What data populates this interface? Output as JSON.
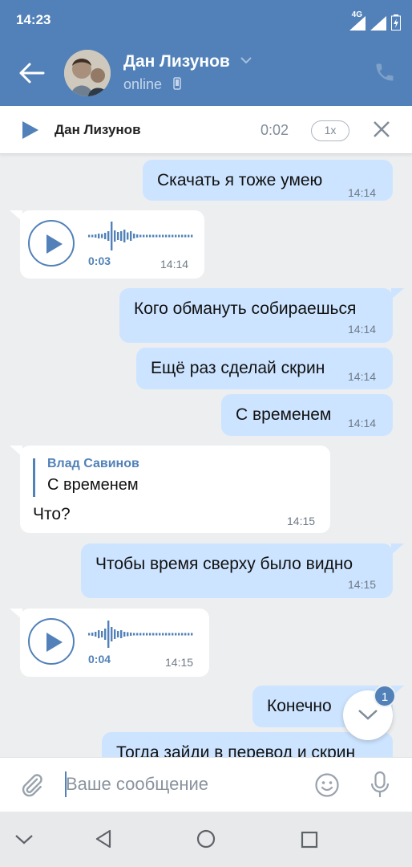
{
  "status_bar": {
    "time": "14:23",
    "network": "4G"
  },
  "header": {
    "contact_name": "Дан Лизунов",
    "status": "online"
  },
  "audio_player": {
    "name": "Дан Лизунов",
    "elapsed": "0:02",
    "speed": "1x"
  },
  "messages": [
    {
      "dir": "out",
      "text": "Скачать я тоже умею",
      "time": "14:14"
    },
    {
      "dir": "in",
      "type": "voice",
      "duration": "0:03",
      "time": "14:14"
    },
    {
      "dir": "out",
      "text": "Кого обмануть собираешься",
      "time": "14:14"
    },
    {
      "dir": "out",
      "text": "Ещё раз сделай скрин",
      "time": "14:14"
    },
    {
      "dir": "out",
      "text": "С временем",
      "time": "14:14"
    },
    {
      "dir": "in",
      "type": "reply",
      "reply_author": "Влад Савинов",
      "reply_text": "С временем",
      "text": "Что?",
      "time": "14:15"
    },
    {
      "dir": "out",
      "text": "Чтобы время сверху было видно",
      "time": "14:15"
    },
    {
      "dir": "in",
      "type": "voice",
      "duration": "0:04",
      "time": "14:15"
    },
    {
      "dir": "out",
      "text": "Конечно",
      "time": ""
    },
    {
      "dir": "out",
      "text": "Тогда зайди в перевод и скрин",
      "time": ""
    }
  ],
  "scroll_badge": "1",
  "composer": {
    "placeholder": "Ваше сообщение"
  },
  "colors": {
    "brand": "#5181b8",
    "outgoing_bubble": "#cce4ff",
    "chat_bg": "#edeef0"
  }
}
